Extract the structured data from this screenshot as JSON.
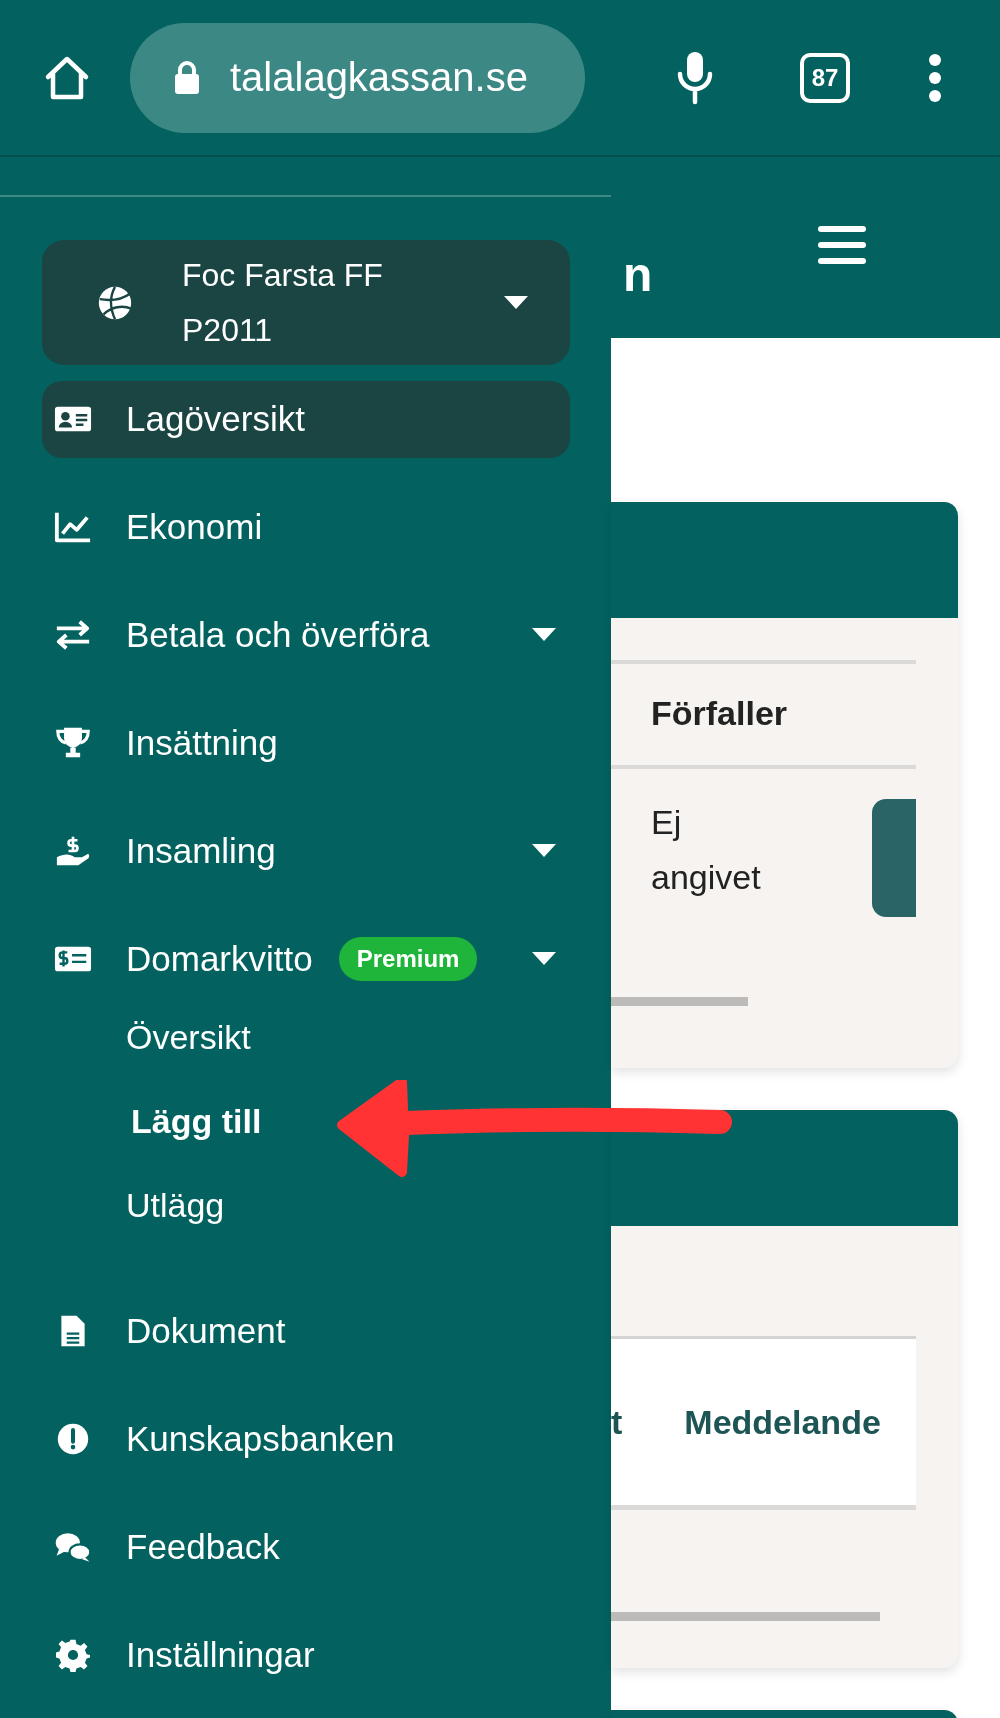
{
  "browser": {
    "url": "talalagkassan.se",
    "tab_count": "87"
  },
  "drawer": {
    "team": "Foc Farsta FF P2011",
    "items": [
      {
        "label": "Lagöversikt",
        "selected": true,
        "dropdown": false
      },
      {
        "label": "Ekonomi",
        "selected": false,
        "dropdown": false
      },
      {
        "label": "Betala och överföra",
        "selected": false,
        "dropdown": true
      },
      {
        "label": "Insättning",
        "selected": false,
        "dropdown": false
      },
      {
        "label": "Insamling",
        "selected": false,
        "dropdown": true
      },
      {
        "label": "Domarkvitto",
        "selected": false,
        "dropdown": true,
        "badge": "Premium",
        "children": [
          {
            "label": "Översikt",
            "selected": false
          },
          {
            "label": "Lägg till",
            "selected": true
          },
          {
            "label": "Utlägg",
            "selected": false
          }
        ]
      },
      {
        "label": "Dokument",
        "selected": false,
        "dropdown": false
      },
      {
        "label": "Kunskapsbanken",
        "selected": false,
        "dropdown": false
      },
      {
        "label": "Feedback",
        "selected": false,
        "dropdown": false
      },
      {
        "label": "Inställningar",
        "selected": false,
        "dropdown": false
      }
    ]
  },
  "page": {
    "logo_fragment": "n",
    "card_1": {
      "column": "Förfaller",
      "cell": "Ej angivet"
    },
    "card_2": {
      "columns": [
        "t",
        "Meddelande"
      ]
    }
  }
}
